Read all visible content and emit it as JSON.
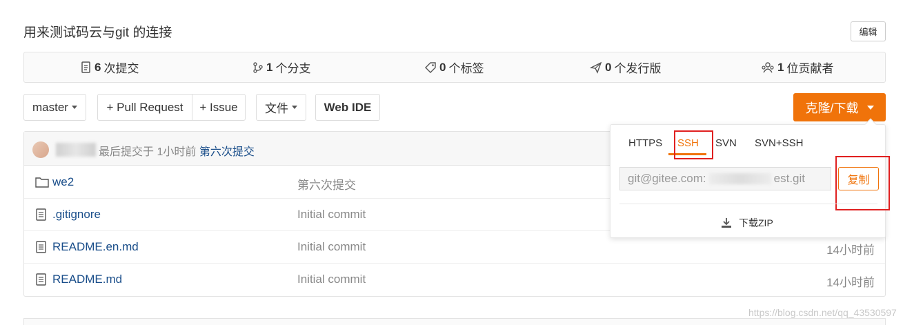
{
  "repo": {
    "description": "用来测试码云与git 的连接",
    "edit_label": "编辑"
  },
  "stats": [
    {
      "icon": "commit-icon",
      "count": "6",
      "label": "次提交"
    },
    {
      "icon": "branch-icon",
      "count": "1",
      "label": "个分支"
    },
    {
      "icon": "tag-icon",
      "count": "0",
      "label": "个标签"
    },
    {
      "icon": "release-icon",
      "count": "0",
      "label": "个发行版"
    },
    {
      "icon": "contributors-icon",
      "count": "1",
      "label": "位贡献者"
    }
  ],
  "toolbar": {
    "branch": "master",
    "pull_request": "+ Pull Request",
    "issue": "+ Issue",
    "files": "文件",
    "web_ide": "Web IDE",
    "clone": "克隆/下载"
  },
  "last_commit": {
    "prefix": "最后提交于 1小时前",
    "message": "第六次提交"
  },
  "files": [
    {
      "type": "folder",
      "name": "we2",
      "message": "第六次提交",
      "time": ""
    },
    {
      "type": "file",
      "name": ".gitignore",
      "message": "Initial commit",
      "time": ""
    },
    {
      "type": "file",
      "name": "README.en.md",
      "message": "Initial commit",
      "time": "14小时前"
    },
    {
      "type": "file",
      "name": "README.md",
      "message": "Initial commit",
      "time": "14小时前"
    }
  ],
  "clone_popup": {
    "tabs": [
      "HTTPS",
      "SSH",
      "SVN",
      "SVN+SSH"
    ],
    "active_tab": "SSH",
    "url_start": "git@gitee.com:",
    "url_end": "est.git",
    "copy_label": "复制",
    "download_zip": "下载ZIP"
  },
  "watermark": "https://blog.csdn.net/qq_43530597",
  "colors": {
    "accent": "#f0730a",
    "link": "#1a4e8a",
    "highlight_box": "#e02020"
  }
}
